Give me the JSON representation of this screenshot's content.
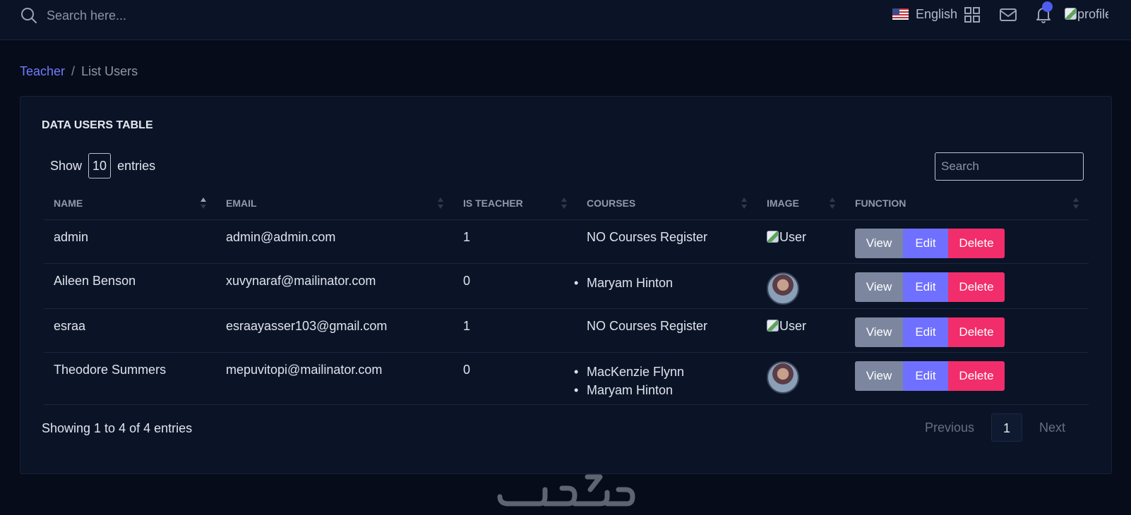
{
  "topbar": {
    "search_placeholder": "Search here...",
    "language": "English",
    "profile_alt": "profile",
    "notification_dot_color": "#4f5cf0"
  },
  "breadcrumb": {
    "parent": "Teacher",
    "separator": "/",
    "current": "List Users"
  },
  "card": {
    "title": "DATA USERS TABLE",
    "show_label": "Show",
    "entries_value": "10",
    "entries_label": "entries",
    "search_placeholder": "Search"
  },
  "table": {
    "columns": [
      "NAME",
      "EMAIL",
      "IS TEACHER",
      "COURSES",
      "IMAGE",
      "FUNCTION"
    ],
    "rows": [
      {
        "name": "admin",
        "email": "admin@admin.com",
        "is_teacher": "1",
        "courses_text": "NO Courses Register",
        "courses": [],
        "image_alt": "User",
        "image_type": "broken"
      },
      {
        "name": "Aileen Benson",
        "email": "xuvynaraf@mailinator.com",
        "is_teacher": "0",
        "courses_text": "",
        "courses": [
          "Maryam Hinton"
        ],
        "image_alt": "",
        "image_type": "avatar"
      },
      {
        "name": "esraa",
        "email": "esraayasser103@gmail.com",
        "is_teacher": "1",
        "courses_text": "NO Courses Register",
        "courses": [],
        "image_alt": "User",
        "image_type": "broken"
      },
      {
        "name": "Theodore Summers",
        "email": "mepuvitopi@mailinator.com",
        "is_teacher": "0",
        "courses_text": "",
        "courses": [
          "MacKenzie Flynn",
          "Maryam Hinton"
        ],
        "image_alt": "",
        "image_type": "avatar"
      }
    ],
    "actions": {
      "view": "View",
      "edit": "Edit",
      "delete": "Delete"
    }
  },
  "footer": {
    "showing": "Showing 1 to 4 of 4 entries",
    "previous": "Previous",
    "page": "1",
    "next": "Next"
  },
  "colors": {
    "accent": "#6f70ff",
    "view_button": "#7c879f",
    "delete_button": "#f22d6b",
    "background": "#060c19",
    "card": "#0b1427"
  }
}
